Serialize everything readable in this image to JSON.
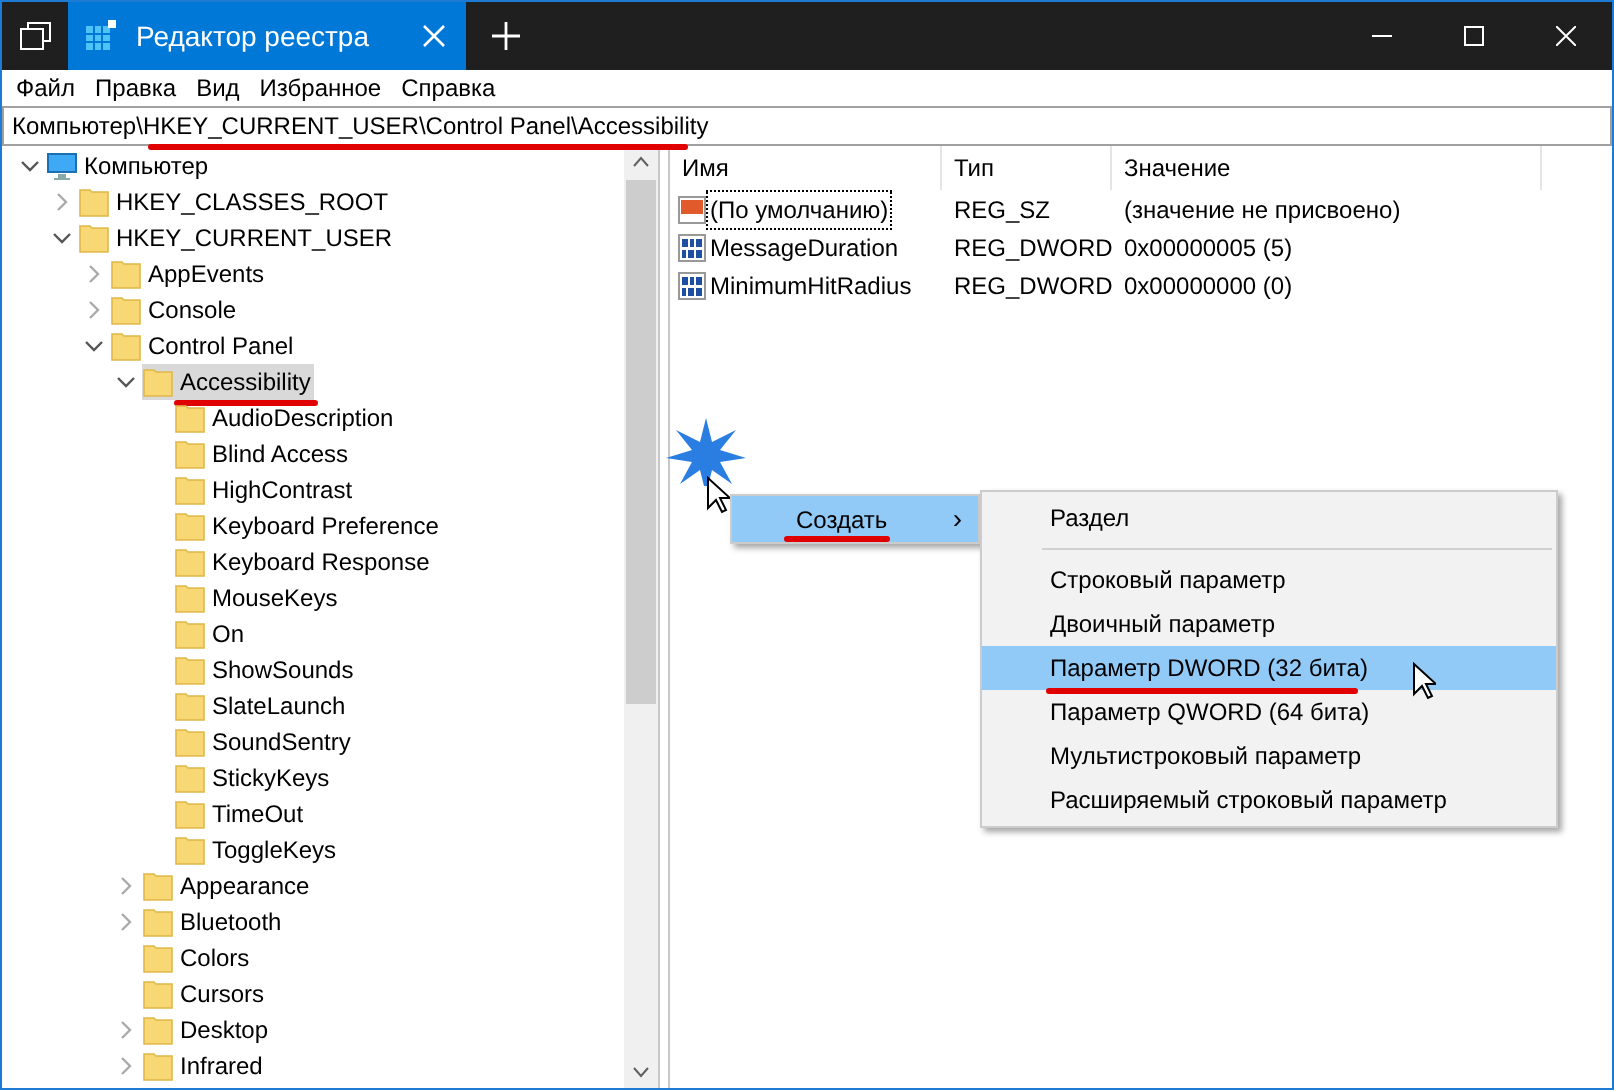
{
  "window": {
    "tab_title": "Редактор реестра"
  },
  "menu": [
    "Файл",
    "Правка",
    "Вид",
    "Избранное",
    "Справка"
  ],
  "address": {
    "value": "Компьютер\\HKEY_CURRENT_USER\\Control Panel\\Accessibility",
    "underlined": true
  },
  "tree": [
    {
      "label": "Компьютер",
      "kind": "computer",
      "expanded": true,
      "selected": false,
      "children": [
        {
          "label": "HKEY_CLASSES_ROOT",
          "kind": "folder",
          "expanded": false,
          "selected": false
        },
        {
          "label": "HKEY_CURRENT_USER",
          "kind": "folder",
          "expanded": true,
          "selected": false,
          "children": [
            {
              "label": "AppEvents",
              "kind": "folder",
              "expanded": false,
              "selected": false
            },
            {
              "label": "Console",
              "kind": "folder",
              "expanded": false,
              "selected": false
            },
            {
              "label": "Control Panel",
              "kind": "folder",
              "expanded": true,
              "selected": false,
              "children": [
                {
                  "label": "Accessibility",
                  "kind": "folder",
                  "expanded": true,
                  "selected": true,
                  "underlined": true,
                  "children": [
                    {
                      "label": "AudioDescription",
                      "kind": "folder",
                      "selected": false
                    },
                    {
                      "label": "Blind Access",
                      "kind": "folder",
                      "selected": false
                    },
                    {
                      "label": "HighContrast",
                      "kind": "folder",
                      "selected": false
                    },
                    {
                      "label": "Keyboard Preference",
                      "kind": "folder",
                      "selected": false
                    },
                    {
                      "label": "Keyboard Response",
                      "kind": "folder",
                      "selected": false
                    },
                    {
                      "label": "MouseKeys",
                      "kind": "folder",
                      "selected": false
                    },
                    {
                      "label": "On",
                      "kind": "folder",
                      "selected": false
                    },
                    {
                      "label": "ShowSounds",
                      "kind": "folder",
                      "selected": false
                    },
                    {
                      "label": "SlateLaunch",
                      "kind": "folder",
                      "selected": false
                    },
                    {
                      "label": "SoundSentry",
                      "kind": "folder",
                      "selected": false
                    },
                    {
                      "label": "StickyKeys",
                      "kind": "folder",
                      "selected": false
                    },
                    {
                      "label": "TimeOut",
                      "kind": "folder",
                      "selected": false
                    },
                    {
                      "label": "ToggleKeys",
                      "kind": "folder",
                      "selected": false
                    }
                  ]
                },
                {
                  "label": "Appearance",
                  "kind": "folder",
                  "expanded": false,
                  "selected": false
                },
                {
                  "label": "Bluetooth",
                  "kind": "folder",
                  "expanded": false,
                  "selected": false
                },
                {
                  "label": "Colors",
                  "kind": "folder",
                  "selected": false
                },
                {
                  "label": "Cursors",
                  "kind": "folder",
                  "selected": false
                },
                {
                  "label": "Desktop",
                  "kind": "folder",
                  "expanded": false,
                  "selected": false
                },
                {
                  "label": "Infrared",
                  "kind": "folder",
                  "expanded": false,
                  "selected": false
                }
              ]
            }
          ]
        }
      ]
    }
  ],
  "table": {
    "columns": [
      "Имя",
      "Тип",
      "Значение"
    ],
    "rows": [
      {
        "kind": "string",
        "name": "(По умолчанию)",
        "focused": true,
        "type": "REG_SZ",
        "value": "(значение не присвоено)"
      },
      {
        "kind": "binary",
        "name": "MessageDuration",
        "focused": false,
        "type": "REG_DWORD",
        "value": "0x00000005 (5)"
      },
      {
        "kind": "binary",
        "name": "MinimumHitRadius",
        "focused": false,
        "type": "REG_DWORD",
        "value": "0x00000000 (0)"
      }
    ]
  },
  "context_menu": {
    "items": [
      {
        "label": "Создать",
        "arrow": "›",
        "selected": true,
        "underlined": true
      }
    ]
  },
  "submenu": {
    "items": [
      {
        "kind": "item",
        "label": "Раздел",
        "selected": false,
        "underlined": false
      },
      {
        "kind": "separator"
      },
      {
        "kind": "item",
        "label": "Строковый параметр",
        "selected": false,
        "underlined": false
      },
      {
        "kind": "item",
        "label": "Двоичный параметр",
        "selected": false,
        "underlined": false
      },
      {
        "kind": "item",
        "label": "Параметр DWORD (32 бита)",
        "selected": true,
        "underlined": true
      },
      {
        "kind": "item",
        "label": "Параметр QWORD (64 бита)",
        "selected": false,
        "underlined": false
      },
      {
        "kind": "item",
        "label": "Мультистроковый параметр",
        "selected": false,
        "underlined": false
      },
      {
        "kind": "item",
        "label": "Расширяемый строковый параметр",
        "selected": false,
        "underlined": false
      }
    ]
  }
}
